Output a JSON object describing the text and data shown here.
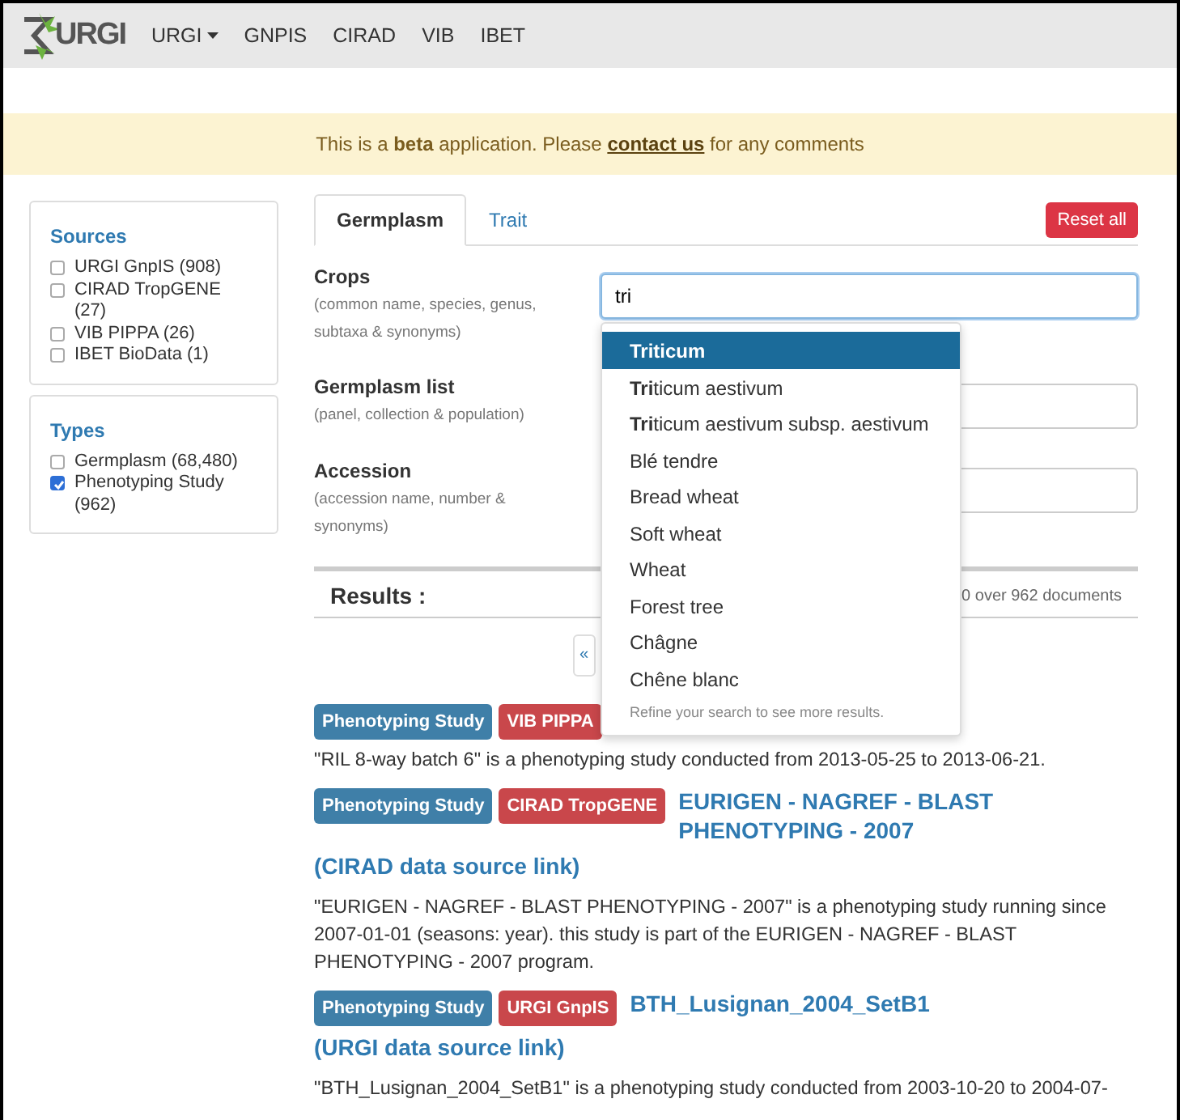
{
  "navbar": {
    "logo_text": "URGI",
    "items": [
      {
        "label": "URGI",
        "dropdown": true
      },
      {
        "label": "GNPIS",
        "dropdown": false
      },
      {
        "label": "CIRAD",
        "dropdown": false
      },
      {
        "label": "VIB",
        "dropdown": false
      },
      {
        "label": "IBET",
        "dropdown": false
      }
    ]
  },
  "alert": {
    "text": "This is a **beta** application. Please",
    "link": "contact us",
    "text_after": "for any comments"
  },
  "sidebar": [
    {
      "title": "Sources",
      "items": [
        {
          "label": "URGI GnpIS (908)",
          "checked": false
        },
        {
          "label": "CIRAD TropGENE (27)",
          "checked": false
        },
        {
          "label": "VIB PIPPA (26)",
          "checked": false
        },
        {
          "label": "IBET BioData (1)",
          "checked": false
        }
      ]
    },
    {
      "title": "Types",
      "items": [
        {
          "label": "Germplasm (68,480)",
          "checked": false
        },
        {
          "label": "Phenotyping Study (962)",
          "checked": true
        }
      ]
    }
  ],
  "tabs": [
    {
      "label": "Germplasm",
      "selected": true
    },
    {
      "label": "Trait",
      "selected": false
    }
  ],
  "reset_button": "Reset all",
  "fields": [
    {
      "label": "Crops",
      "hint": "(common name, species, genus, subtaxa & synonyms)",
      "value": "tri"
    },
    {
      "label": "Germplasm list",
      "hint": "(panel, collection & population)"
    },
    {
      "label": "Accession",
      "hint": "(accession name, number & synonyms)"
    }
  ],
  "autocomplete": {
    "items": [
      {
        "text": "**Tri**ticum",
        "selected": true
      },
      {
        "text": "**Tri**ticum aestivum",
        "selected": false
      },
      {
        "text": "**Tri**ticum aestivum subsp. aestivum",
        "selected": false
      },
      {
        "text": "Blé tendre",
        "selected": false
      },
      {
        "text": "Bread wheat",
        "selected": false
      },
      {
        "text": "Soft wheat",
        "selected": false
      },
      {
        "text": "Wheat",
        "selected": false
      },
      {
        "text": "Forest tree",
        "selected": false
      },
      {
        "text": "Châgne",
        "selected": false
      },
      {
        "text": "Chêne blanc",
        "selected": false
      }
    ],
    "footer": "Refine your search to see more results."
  },
  "results": {
    "title": "Results :",
    "count_text": "0 over 962 documents",
    "pagination": [
      "«"
    ],
    "items": [
      {
        "badges": [
          {
            "text": "Phenotyping Study",
            "kind": "type"
          },
          {
            "text": "VIB PIPPA",
            "kind": "source"
          }
        ],
        "description": "\"RIL 8-way batch 6\" is a phenotyping study conducted from 2013-05-25 to 2013-06-21."
      },
      {
        "badges": [
          {
            "text": "Phenotyping Study",
            "kind": "type"
          },
          {
            "text": "CIRAD TropGENE",
            "kind": "source"
          }
        ],
        "title": "EURIGEN - NAGREF - BLAST PHENOTYPING - 2007",
        "source_link": "(CIRAD data source link)",
        "description": "\"EURIGEN - NAGREF - BLAST PHENOTYPING - 2007\" is a phenotyping study running since 2007-01-01 (seasons: year). this study is part of the EURIGEN - NAGREF - BLAST PHENOTYPING - 2007 program."
      },
      {
        "badges": [
          {
            "text": "Phenotyping Study",
            "kind": "type"
          },
          {
            "text": "URGI GnpIS",
            "kind": "source"
          }
        ],
        "title": "BTH_Lusignan_2004_SetB1",
        "source_link": "(URGI data source link)",
        "description": "\"BTH_Lusignan_2004_SetB1\" is a phenotyping study conducted from 2003-10-20 to 2004-07-"
      }
    ]
  }
}
